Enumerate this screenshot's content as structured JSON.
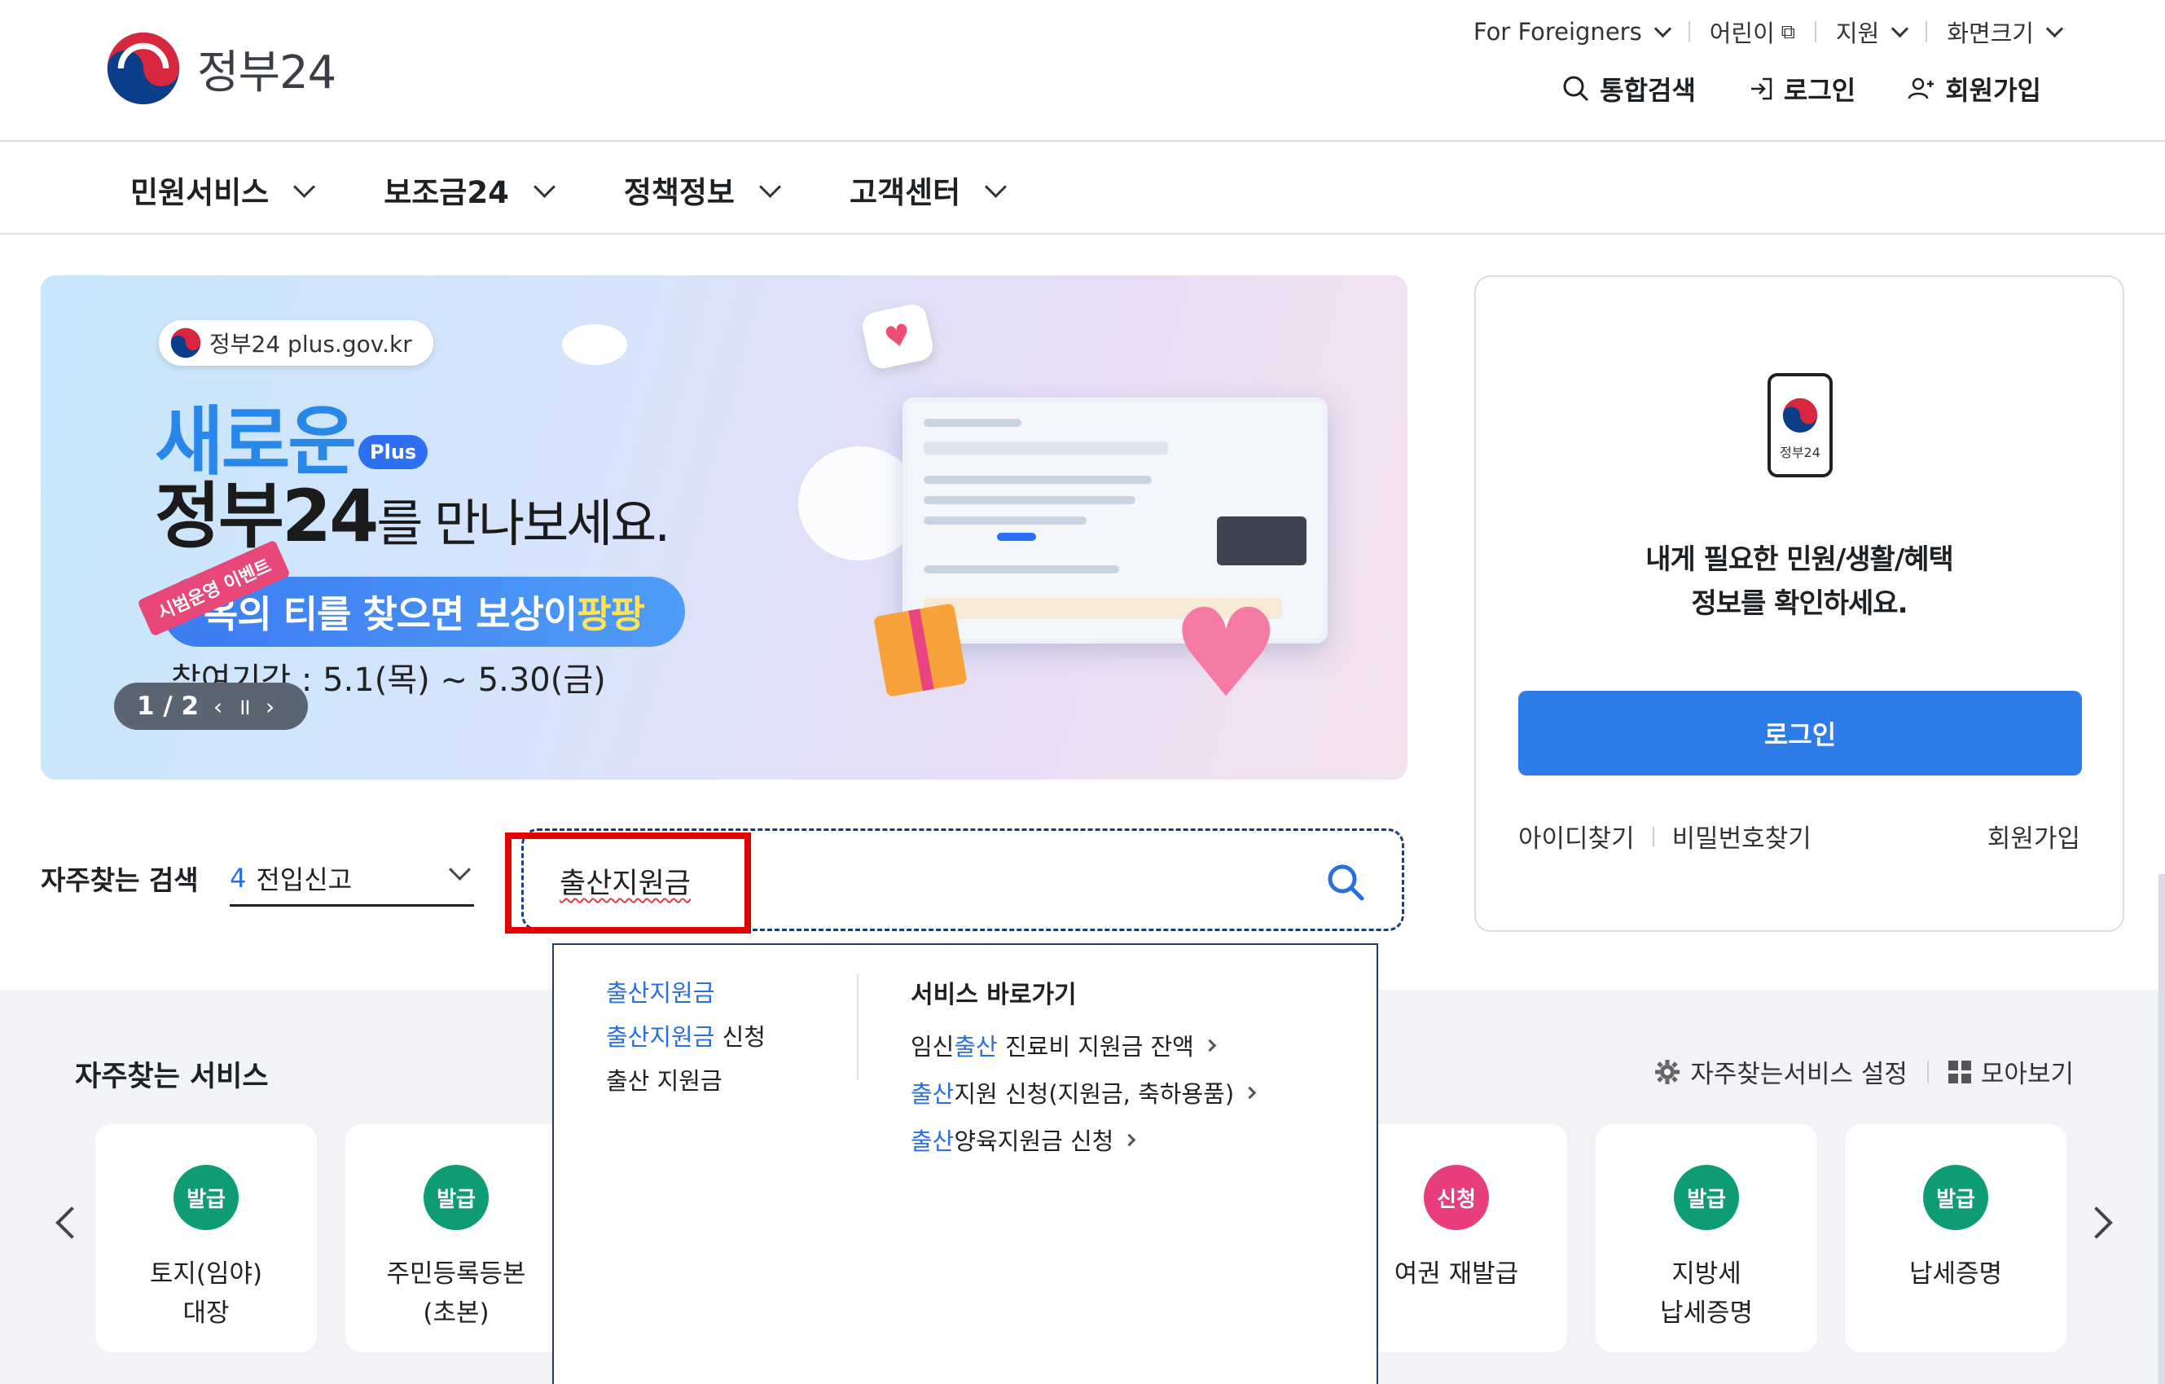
{
  "header": {
    "logo_text": "정부24",
    "util": [
      {
        "label": "For Foreigners",
        "icon": "chevron-down-icon"
      },
      {
        "label": "어린이",
        "icon": "external-link-icon"
      },
      {
        "label": "지원",
        "icon": "chevron-down-icon"
      },
      {
        "label": "화면크기",
        "icon": "chevron-down-icon"
      }
    ],
    "search_label": "통합검색",
    "login_label": "로그인",
    "signup_label": "회원가입"
  },
  "nav": {
    "items": [
      "민원서비스",
      "보조금24",
      "정책정보",
      "고객센터"
    ]
  },
  "banner": {
    "site_pill": "정부24 plus.gov.kr",
    "headline_new": "새로운",
    "plus_badge": "Plus",
    "headline_main": "정부24",
    "headline_rest": "를 만나보세요.",
    "event_tag": "시범운영 이벤트",
    "event_pre": "옥의 티",
    "event_mid": "를 찾으면 보상이 ",
    "event_post": "팡팡",
    "period": "참여기간 : 5.1(목) ~ 5.30(금)",
    "pager": "1 / 2",
    "prev": "‹",
    "pause": "॥",
    "next": "›"
  },
  "search": {
    "frequent_label": "자주찾는 검색",
    "frequent_num": "4",
    "frequent_value": "전입신고",
    "value": "출산지원금"
  },
  "autocomplete": {
    "suggestions": [
      {
        "hl": "출산지원금",
        "rest": ""
      },
      {
        "hl": "출산지원금",
        "rest": " 신청"
      },
      {
        "hl": "",
        "rest": "출산 지원금"
      }
    ],
    "shortcut_title": "서비스 바로가기",
    "shortcuts": [
      {
        "pre": "임신",
        "hl": "출산",
        "post": " 진료비 지원금 잔액"
      },
      {
        "pre": "",
        "hl": "출산",
        "post": "지원 신청(지원금, 축하용품)"
      },
      {
        "pre": "",
        "hl": "출산",
        "post": "양육지원금 신청"
      }
    ]
  },
  "login_card": {
    "phone_label": "정부24",
    "message_line1": "내게 필요한 민원/생활/혜택",
    "message_line2": "정보를 확인하세요.",
    "login_button": "로그인",
    "find_id": "아이디찾기",
    "find_pw": "비밀번호찾기",
    "signup": "회원가입"
  },
  "services": {
    "title": "자주찾는 서비스",
    "settings_label": "자주찾는서비스 설정",
    "collect_label": "모아보기",
    "cards": [
      {
        "badge": "발급",
        "color": "#0d9c74",
        "label": "토지(임야)\n대장"
      },
      {
        "badge": "발급",
        "color": "#0d9c74",
        "label": "주민등록등본\n(초본)"
      },
      {
        "badge": "신청",
        "color": "#e83e7d",
        "label": "여권 재발급"
      },
      {
        "badge": "발급",
        "color": "#0d9c74",
        "label": "지방세\n납세증명"
      },
      {
        "badge": "발급",
        "color": "#0d9c74",
        "label": "납세증명"
      }
    ]
  },
  "colors": {
    "primary": "#2e7ce8",
    "highlight": "#2a6fe0",
    "badge_green": "#0d9c74",
    "badge_pink": "#e83e7d",
    "annotation_red": "#e50000"
  }
}
